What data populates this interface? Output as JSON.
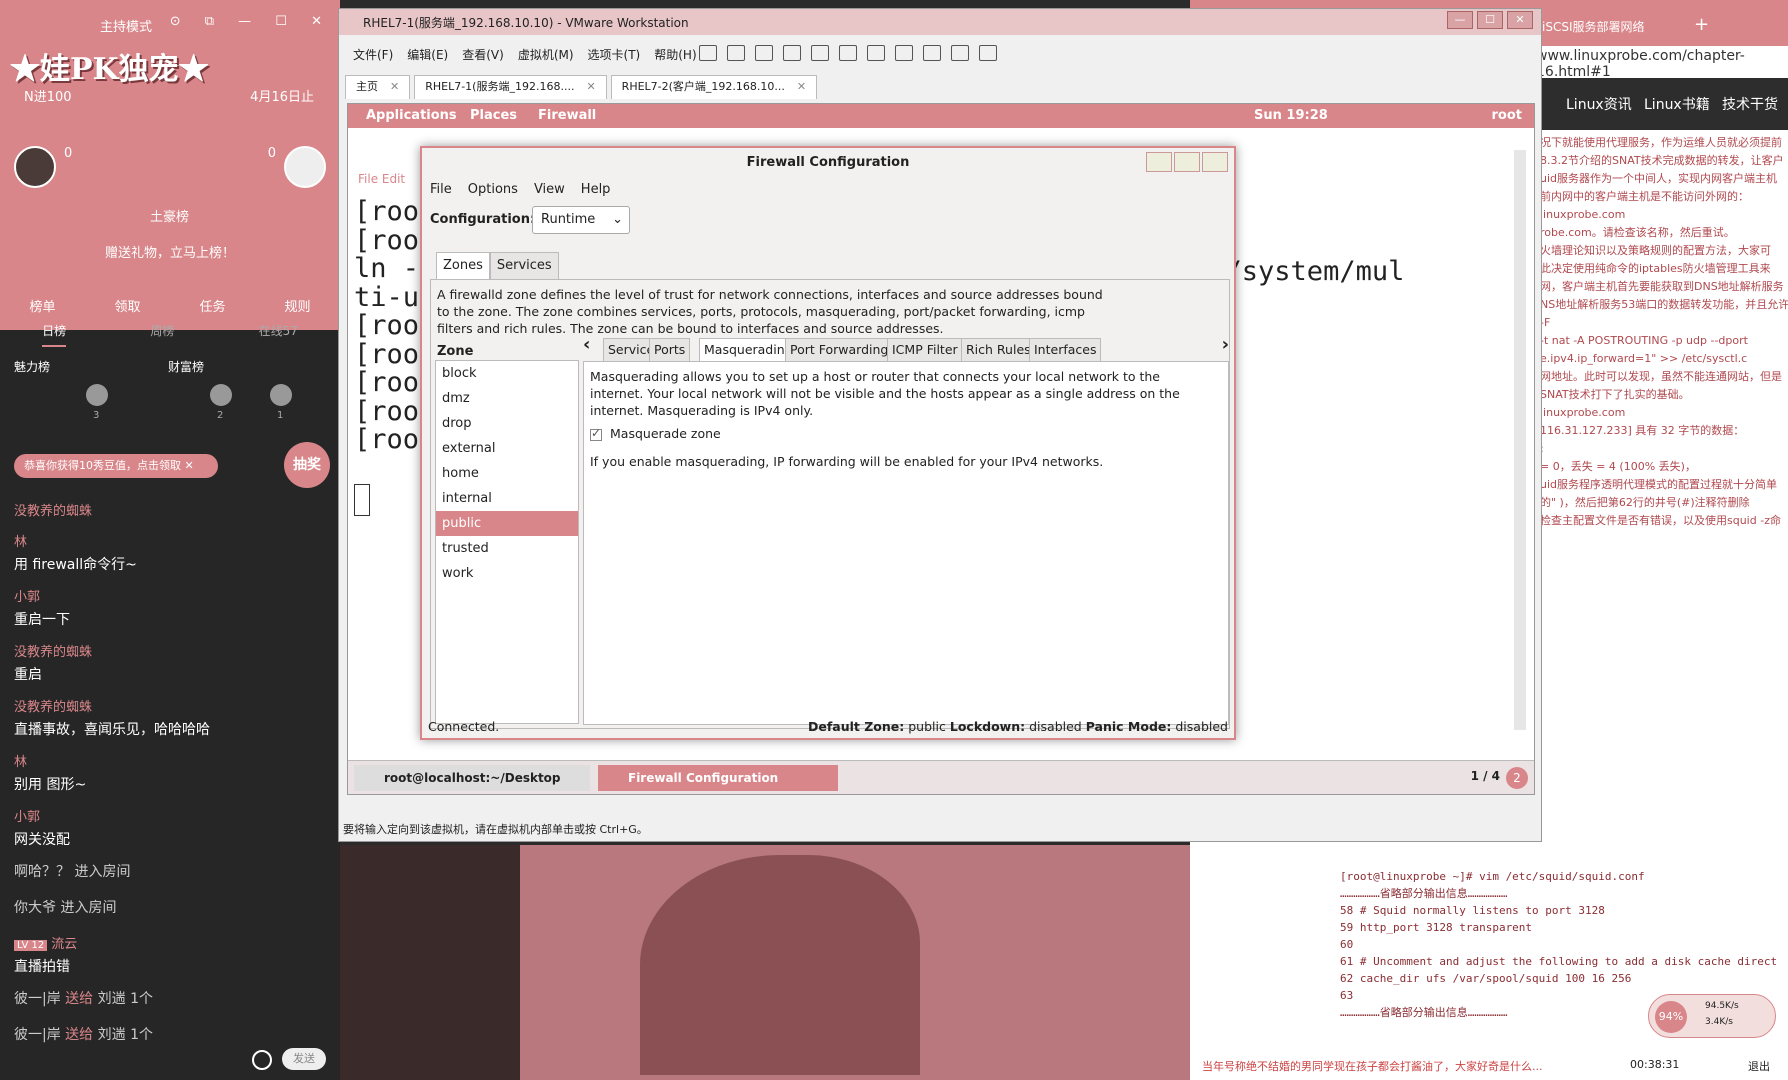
{
  "live": {
    "host_title": "主持模式",
    "banner": "★娃PK独宠★",
    "n_label": "N进100",
    "date_label": "4月16日止",
    "score_left": "0",
    "score_right": "0",
    "crown_label": "土豪榜",
    "gift_prompt": "赠送礼物，立马上榜！",
    "actions": [
      "榜单",
      "领取",
      "任务",
      "规则"
    ],
    "tabs": [
      "日榜",
      "周榜",
      "在线57"
    ],
    "rank_left": "魅力榜",
    "rank_right": "财富榜",
    "rank_nums": [
      "3",
      "2",
      "1"
    ],
    "toast": "恭喜你获得10秀豆值，点击领取",
    "lottery": "抽奖",
    "chat": [
      {
        "who": "没教养的蜘蛛",
        "text": ""
      },
      {
        "who": "林",
        "text": "用 firewall命令行~"
      },
      {
        "who": "小郭",
        "text": "重启一下"
      },
      {
        "who": "没教养的蜘蛛",
        "text": "重启"
      },
      {
        "who": "没教养的蜘蛛",
        "text": "直播事故，喜闻乐见，哈哈哈哈"
      },
      {
        "who": "林",
        "text": "别用 图形~"
      },
      {
        "who": "小郭",
        "text": "网关没配"
      }
    ],
    "sys": [
      {
        "text": "啊哈？？ 进入房间"
      },
      {
        "text": "你大爷 进入房间"
      }
    ],
    "badge": "LV 12",
    "badge_user": "流云",
    "badge_msg": "直播拍错",
    "gift_msgs": [
      {
        "from": "彼一|岸",
        "verb": "送给",
        "to": "刘遄 1个"
      },
      {
        "from": "彼一|岸",
        "verb": "送给",
        "to": "刘遄 1个"
      }
    ],
    "send": "发送"
  },
  "vmware": {
    "title": "RHEL7-1(服务端_192.168.10.10) - VMware Workstation",
    "menus": [
      "文件(F)",
      "编辑(E)",
      "查看(V)",
      "虚拟机(M)",
      "选项卡(T)",
      "帮助(H)"
    ],
    "tabs": [
      {
        "label": "主页"
      },
      {
        "label": "RHEL7-1(服务端_192.168...."
      },
      {
        "label": "RHEL7-2(客户端_192.168.10..."
      }
    ],
    "status": "要将输入定向到该虚拟机，请在虚拟机内部单击或按 Ctrl+G。"
  },
  "guest": {
    "applications": "Applications",
    "places": "Places",
    "firewall": "Firewall",
    "clock": "Sun 19:28",
    "user": "root",
    "term_menu": "File   Edit",
    "term_lines": [
      "[root",
      "[root",
      "ln -s",
      "ti-us",
      "[root",
      "[root",
      "[root",
      "[root",
      "[root"
    ],
    "term_right": "ystemd/system/mul",
    "task1": "root@localhost:~/Desktop",
    "task2": "Firewall Configuration",
    "pager": "1 / 4",
    "pager_badge": "2"
  },
  "firewall": {
    "title": "Firewall Configuration",
    "menus": [
      "File",
      "Options",
      "View",
      "Help"
    ],
    "config_label": "Configuration:",
    "config_value": "Runtime",
    "main_tabs": [
      "Zones",
      "Services"
    ],
    "description": "A firewalld zone defines the level of trust for network connections, interfaces and source addresses bound to the zone. The zone combines services, ports, protocols, masquerading, port/packet forwarding, icmp filters and rich rules. The zone can be bound to interfaces and source addresses.",
    "zone_label": "Zone",
    "zones": [
      "block",
      "dmz",
      "drop",
      "external",
      "home",
      "internal",
      "public",
      "trusted",
      "work"
    ],
    "selected_zone": "public",
    "zone_tabs": [
      "Services",
      "Ports",
      "Masquerading",
      "Port Forwarding",
      "ICMP Filter",
      "Rich Rules",
      "Interfaces"
    ],
    "active_zone_tab": "Masquerading",
    "masq_desc": "Masquerading allows you to set up a host or router that connects your local network to the internet. Your local network will not be visible and the hosts appear as a single address on the internet. Masquerading is IPv4 only.",
    "masq_checkbox": "Masquerade zone",
    "masq_note": "If you enable masquerading, IP forwarding will be enabled for your IPv4 networks.",
    "status_left": "Connected.",
    "default_zone_label": "Default Zone:",
    "default_zone": "public",
    "lockdown_label": "Lockdown:",
    "lockdown": "disabled",
    "panic_label": "Panic Mode:",
    "panic": "disabled"
  },
  "web": {
    "tab_title": "用iSCSI服务部署网络",
    "url": "www.linuxprobe.com/chapter-16.html#1",
    "nav": [
      "Linux资讯",
      "Linux书籍",
      "技术干货"
    ],
    "content": [
      "况下就能使用代理服务，作为运维人员就必须提前",
      "8.3.2节介绍的SNAT技术完成数据的转发，让客户",
      "uid服务器作为一个中间人，实现内网客户端主机",
      "",
      "前内网中的客户端主机是不能访问外网的：",
      "",
      "",
      "linuxprobe.com",
      "robe.com。请检查该名称，然后重试。",
      "",
      "",
      "火墙理论知识以及策略规则的配置方法，大家可",
      "此决定使用纯命令的iptables防火墙管理工具来",
      "",
      "网，客户端主机首先要能获取到DNS地址解析服务",
      "NS地址解析服务53端口的数据转发功能，并且允许",
      "",
      "",
      "",
      "-F",
      "-t nat -A POSTROUTING -p udp --dport",
      "",
      "",
      "e.ipv4.ip_forward=1\" >> /etc/sysctl.c",
      "",
      "",
      "",
      "",
      "网地址。此时可以发现，虽然不能连通网站，但是",
      "SNAT技术打下了扎实的基础。",
      "",
      "",
      "linuxprobe.com",
      "116.31.127.233] 具有 32 字节的数据：",
      "",
      "",
      "",
      "",
      "",
      ":",
      "= 0，丢失 = 4 (100% 丢失)，",
      "",
      "",
      "uid服务程序透明代理模式的配置过程就十分简单",
      "的\" )，然后把第62行的井号(#)注释符删除",
      "检查主配置文件是否有错误，以及使用squid -z命"
    ],
    "code": [
      "[root@linuxprobe ~]# vim /etc/squid/squid.conf",
      "………………省略部分输出信息………………",
      "58 # Squid normally listens to port 3128",
      "59 http_port 3128 transparent",
      "60",
      "61 # Uncomment and adjust the following to add a disk cache direct",
      "62 cache_dir ufs /var/spool/squid 100 16 256",
      "63",
      "………………省略部分输出信息………………"
    ],
    "footer_tip": "当年号称绝不结婚的男同学现在孩子都会打酱油了，大家好奇是什么...",
    "net_up": "94.5K/s",
    "net_down": "3.4K/s",
    "cpu": "94%",
    "timer": "00:38:31",
    "exit": "退出"
  }
}
